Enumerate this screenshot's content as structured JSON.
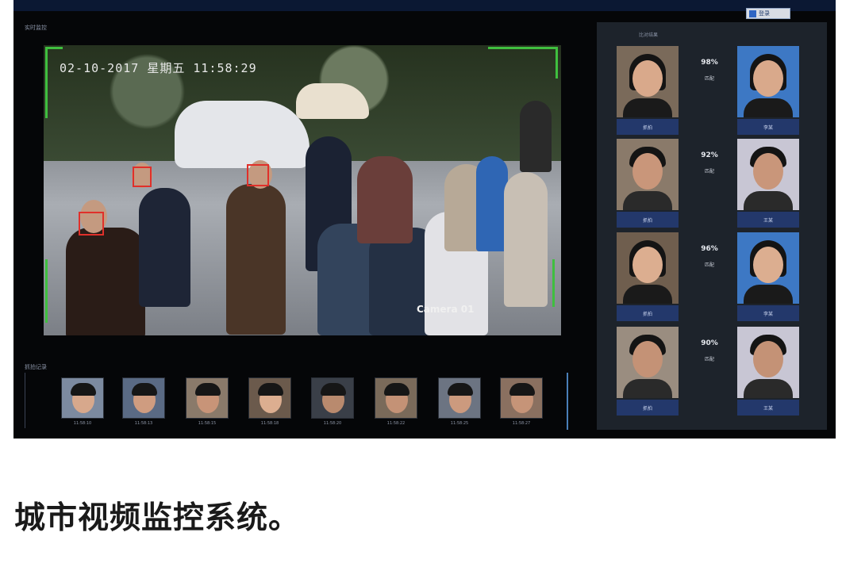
{
  "header": {
    "login_button": "登录",
    "live_label": "实时监控",
    "compare_label": "比对结果",
    "capture_label": "抓拍记录"
  },
  "video": {
    "timestamp": "02-10-2017 星期五 11:58:29",
    "camera_label": "Camera 01"
  },
  "captures": [
    {
      "time": "11:58:10"
    },
    {
      "time": "11:58:13"
    },
    {
      "time": "11:58:15"
    },
    {
      "time": "11:58:18"
    },
    {
      "time": "11:58:20"
    },
    {
      "time": "11:58:22"
    },
    {
      "time": "11:58:25"
    },
    {
      "time": "11:58:27"
    }
  ],
  "comparisons": [
    {
      "score": "98%",
      "status": "匹配",
      "capture_name": "抓拍",
      "db_name": "李某",
      "skin": "#d9a98b",
      "bg": "#7a6a5a",
      "db_bg": "#3d78c4",
      "body": "#1a1a1a",
      "hair_long": true
    },
    {
      "score": "92%",
      "status": "匹配",
      "capture_name": "抓拍",
      "db_name": "王某",
      "skin": "#c9967a",
      "bg": "#8a7a6a",
      "db_bg": "#c8c6d4",
      "body": "#2a2a2a",
      "hair_long": false
    },
    {
      "score": "96%",
      "status": "匹配",
      "capture_name": "抓拍",
      "db_name": "李某",
      "skin": "#dcae90",
      "bg": "#6f5e4e",
      "db_bg": "#3d78c4",
      "body": "#1a1a1a",
      "hair_long": true
    },
    {
      "score": "90%",
      "status": "匹配",
      "capture_name": "抓拍",
      "db_name": "王某",
      "skin": "#c49276",
      "bg": "#9a8d80",
      "db_bg": "#c8c6d4",
      "body": "#2a2a2a",
      "hair_long": false
    }
  ],
  "caption": "城市视频监控系统。",
  "colors": {
    "frame_green": "#3fbf3f",
    "detect_red": "#e0302a",
    "name_bar": "#23386b"
  }
}
